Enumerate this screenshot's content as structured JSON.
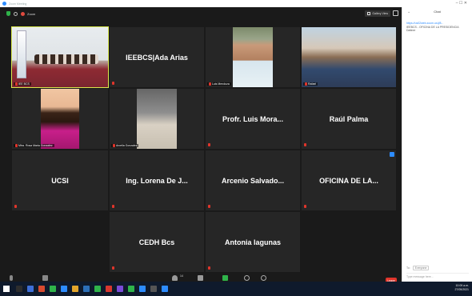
{
  "window": {
    "title": "Zoom Meeting",
    "controls": "–  ☐  ✕"
  },
  "topbar": {
    "label": "Zoom"
  },
  "view_button": {
    "label": "Gallery View"
  },
  "tiles": [
    {
      "id": "t1",
      "label": "IEE BCS",
      "kind": "photo-conf",
      "active": true
    },
    {
      "id": "t2",
      "big": "IEEBCS|Ada Arias"
    },
    {
      "id": "t3",
      "label": "Luis Mendoza",
      "kind": "photo-man1"
    },
    {
      "id": "t4",
      "label": "Rafael",
      "kind": "photo-outdoor"
    },
    {
      "id": "t5",
      "label": "Mtra. Rosa Maria Gonzalez",
      "kind": "photo-woman"
    },
    {
      "id": "t6",
      "label": "Arcelia Gonzalez",
      "kind": "photo-dark"
    },
    {
      "id": "t7",
      "big": "Profr. Luis Mora..."
    },
    {
      "id": "t8",
      "big": "Raúl Palma"
    },
    {
      "id": "t9",
      "big": "UCSI"
    },
    {
      "id": "t10",
      "big": "Ing. Lorena De J..."
    },
    {
      "id": "t11",
      "big": "Arcenio  Salvado..."
    },
    {
      "id": "t12",
      "big": "OFICINA DE LA...",
      "pin": true
    },
    {
      "id": "t13",
      "big": "CEDH Bcs"
    },
    {
      "id": "t14",
      "big": "Antonia lagunas"
    }
  ],
  "toolbar": {
    "unmute": "Unmute",
    "start_video": "Start Video",
    "participants": "Participants",
    "participants_count": "14",
    "chat": "Chat",
    "share": "Share Screen",
    "record": "Record",
    "reactions": "Reactions",
    "leave": "Leave"
  },
  "chat": {
    "title": "Chat",
    "link": "https://us02web.zoom.us/j/8...",
    "message": "IEEBCS - OFICINA DE LA PRESIDENCIA",
    "sender": "Dattner",
    "to_label": "To:",
    "to_value": "Everyone",
    "placeholder": "Type message here..."
  },
  "taskbar": {
    "time": "10:09 a.m.",
    "date": "27/05/2021"
  }
}
